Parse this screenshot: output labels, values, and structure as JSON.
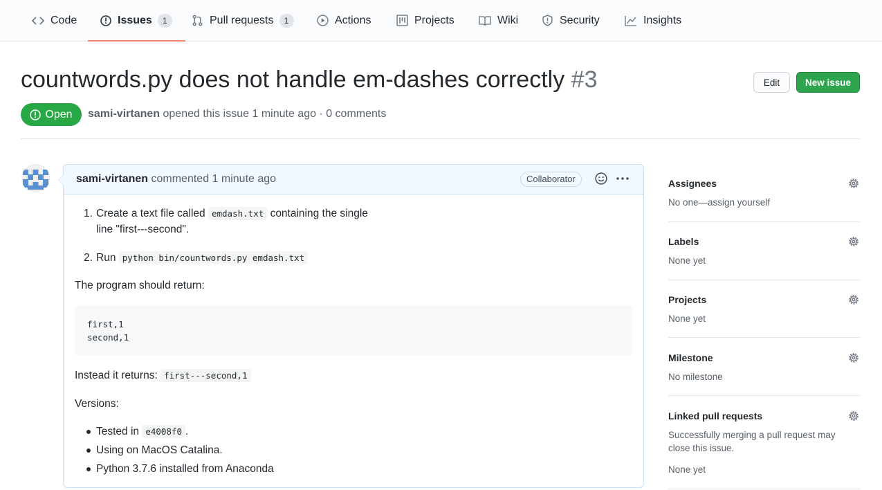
{
  "nav": {
    "tabs": [
      {
        "label": "Code"
      },
      {
        "label": "Issues",
        "count": "1"
      },
      {
        "label": "Pull requests",
        "count": "1"
      },
      {
        "label": "Actions"
      },
      {
        "label": "Projects"
      },
      {
        "label": "Wiki"
      },
      {
        "label": "Security"
      },
      {
        "label": "Insights"
      }
    ],
    "selected": "Issues"
  },
  "issue": {
    "title": "countwords.py does not handle em-dashes correctly",
    "number": "#3",
    "state": "Open",
    "author": "sami-virtanen",
    "opened_text": "opened this issue 1 minute ago · 0 comments"
  },
  "header_buttons": {
    "edit": "Edit",
    "new_issue": "New issue"
  },
  "comment": {
    "author": "sami-virtanen",
    "action": "commented 1 minute ago",
    "badge": "Collaborator",
    "steps": {
      "s1_num": "1.",
      "s1_text_a": "Create a text file called",
      "s1_code": "emdash.txt",
      "s1_text_b": "containing the single",
      "s1_text_c": "line \"first---second\".",
      "s2_num": "2.",
      "s2_text": "Run",
      "s2_code": "python bin/countwords.py emdash.txt"
    },
    "expect_text": "The program should return:",
    "code_lines": [
      "first,1",
      "second,1"
    ],
    "instead_text": "Instead it returns:",
    "instead_code": "first---second,1",
    "versions_title": "Versions:",
    "versions": {
      "v1_text": "Tested in",
      "v1_code": "e4008f0",
      "v1_end": ".",
      "v2_text": "Using on MacOS Catalina.",
      "v3_text": "Python 3.7.6 installed from Anaconda"
    }
  },
  "sidebar": [
    {
      "title": "Assignees",
      "text": "No one—assign yourself"
    },
    {
      "title": "Labels",
      "text": "None yet"
    },
    {
      "title": "Projects",
      "text": "None yet"
    },
    {
      "title": "Milestone",
      "text": "No milestone"
    },
    {
      "title": "Linked pull requests",
      "text_line1": "Successfully merging a pull request may",
      "text_line2": "close this issue.",
      "text": "None yet"
    }
  ],
  "colors": {
    "accent": "#f9826c",
    "open": "#28a745",
    "new_issue": "#2ea44f"
  },
  "icons": [
    "code-icon",
    "issue-opened-icon",
    "git-pull-request-icon",
    "play-icon",
    "project-icon",
    "book-icon",
    "shield-icon",
    "graph-icon",
    "smiley-icon",
    "kebab-horizontal-icon",
    "gear-icon"
  ]
}
